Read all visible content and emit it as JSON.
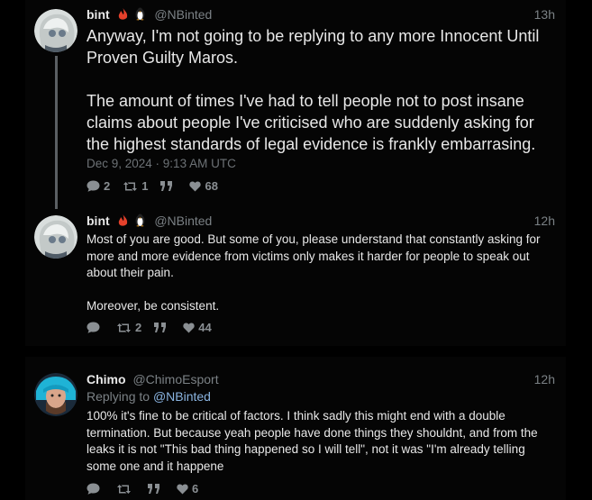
{
  "posts": [
    {
      "name": "bint",
      "handle": "@NBinted",
      "time": "13h",
      "paragraphs": [
        "Anyway, I'm not going to be replying to any more Innocent Until Proven Guilty Maros.",
        "The amount of times I've had to tell people not to post insane claims about people I've criticised who are suddenly asking for the highest standards of legal evidence is frankly embarrasing."
      ],
      "date": "Dec 9, 2024 · 9:13 AM UTC",
      "replies": "2",
      "retweets": "1",
      "quotes": "",
      "likes": "68"
    },
    {
      "name": "bint",
      "handle": "@NBinted",
      "time": "12h",
      "paragraphs": [
        "Most of you are good. But some of you, please understand that constantly asking for more and more evidence from victims only makes it harder for people to speak out about their pain.",
        "Moreover, be consistent."
      ],
      "replies": "",
      "retweets": "2",
      "quotes": "",
      "likes": "44"
    },
    {
      "name": "Chimo",
      "handle": "@ChimoEsport",
      "time": "12h",
      "replying_prefix": "Replying to ",
      "replying_handle": "@NBinted",
      "paragraphs": [
        "100% it's fine to be critical of factors. I think sadly this might end with a double termination. But because yeah people have done things they shouldnt, and from the leaks it is not \"This bad thing happened so I will tell\", not it was \"I'm already telling some one and it happene"
      ],
      "replies": "",
      "retweets": "",
      "quotes": "",
      "likes": "6"
    }
  ],
  "icons": {
    "reply": "comment-icon",
    "retweet": "retweet-icon",
    "quote": "quote-icon",
    "like": "heart-icon",
    "badge1": "fire-emoji-icon",
    "badge2": "penguin-emoji-icon"
  },
  "colors": {
    "background": "#000000",
    "panel": "#050505",
    "text": "#e8e8e8",
    "muted": "#7b8185",
    "link": "#8ab4e0"
  }
}
